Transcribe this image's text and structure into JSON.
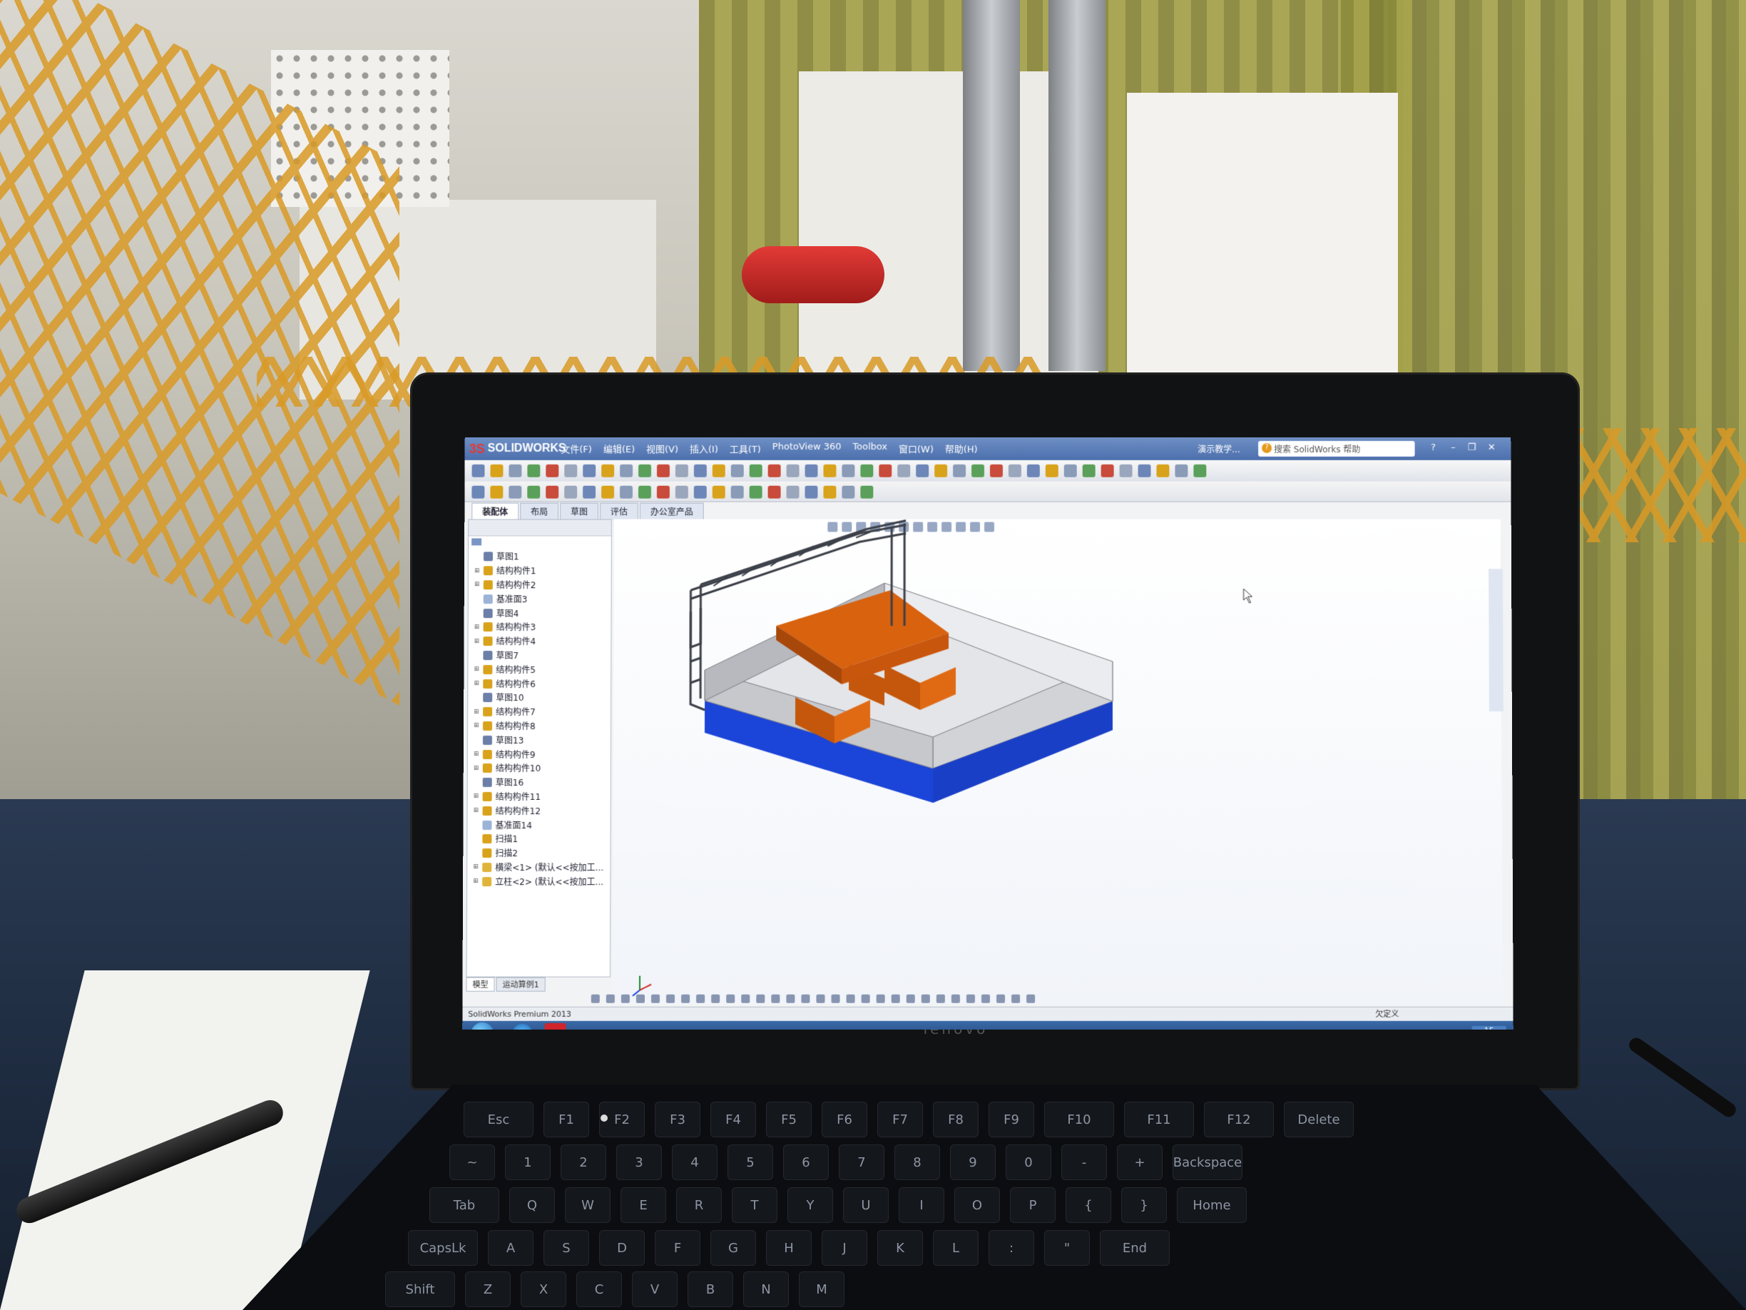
{
  "scene": {
    "description_hidden": ""
  },
  "app": {
    "logo_text": "SOLIDWORKS",
    "logo_prefix": "3S",
    "menu": [
      "文件(F)",
      "编辑(E)",
      "视图(V)",
      "插入(I)",
      "工具(T)",
      "PhotoView 360",
      "Toolbox",
      "窗口(W)",
      "帮助(H)"
    ],
    "demo_label": "演示教学...",
    "search_placeholder": "搜索 SolidWorks 帮助",
    "window_controls": [
      "?",
      "–",
      "❐",
      "✕"
    ]
  },
  "command_tabs": [
    {
      "label": "装配体",
      "active": true
    },
    {
      "label": "布局",
      "active": false
    },
    {
      "label": "草图",
      "active": false
    },
    {
      "label": "评估",
      "active": false
    },
    {
      "label": "办公室产品",
      "active": false
    }
  ],
  "feature_tree": {
    "items": [
      {
        "label": "草图1",
        "type": "sketch"
      },
      {
        "label": "结构构件1",
        "type": "member"
      },
      {
        "label": "结构构件2",
        "type": "member"
      },
      {
        "label": "基准面3",
        "type": "plane"
      },
      {
        "label": "草图4",
        "type": "sketch"
      },
      {
        "label": "结构构件3",
        "type": "member"
      },
      {
        "label": "结构构件4",
        "type": "member"
      },
      {
        "label": "草图7",
        "type": "sketch"
      },
      {
        "label": "结构构件5",
        "type": "member"
      },
      {
        "label": "结构构件6",
        "type": "member"
      },
      {
        "label": "草图10",
        "type": "sketch"
      },
      {
        "label": "结构构件7",
        "type": "member"
      },
      {
        "label": "结构构件8",
        "type": "member"
      },
      {
        "label": "草图13",
        "type": "sketch"
      },
      {
        "label": "结构构件9",
        "type": "member"
      },
      {
        "label": "结构构件10",
        "type": "member"
      },
      {
        "label": "草图16",
        "type": "sketch"
      },
      {
        "label": "结构构件11",
        "type": "member"
      },
      {
        "label": "结构构件12",
        "type": "member"
      },
      {
        "label": "基准面14",
        "type": "plane"
      },
      {
        "label": "扫描1",
        "type": "sweep"
      },
      {
        "label": "扫描2",
        "type": "sweep"
      },
      {
        "label": "横梁<1> (默认<<按加工...",
        "type": "part"
      },
      {
        "label": "立柱<2> (默认<<按加工...",
        "type": "part"
      }
    ],
    "bottom_tabs": [
      {
        "label": "模型",
        "active": true
      },
      {
        "label": "运动算例1",
        "active": false
      }
    ]
  },
  "status_bar": {
    "text": "SolidWorks Premium 2013",
    "right_text": "欠定义"
  },
  "taskbar": {
    "sw_label": "SW",
    "clock": "15"
  },
  "laptop": {
    "brand": "lenovo"
  },
  "keyboard": {
    "row_fn": [
      "Esc",
      "F1",
      "F2",
      "F3",
      "F4",
      "F5",
      "F6",
      "F7",
      "F8",
      "F9",
      "F10",
      "F11",
      "F12",
      "Delete"
    ],
    "row_num": [
      "~",
      "1",
      "2",
      "3",
      "4",
      "5",
      "6",
      "7",
      "8",
      "9",
      "0",
      "-",
      "+",
      "Backspace"
    ],
    "row_q": [
      "Tab",
      "Q",
      "W",
      "E",
      "R",
      "T",
      "Y",
      "U",
      "I",
      "O",
      "P",
      "{",
      "}",
      "Home"
    ],
    "row_a": [
      "CapsLk",
      "A",
      "S",
      "D",
      "F",
      "G",
      "H",
      "J",
      "K",
      "L",
      ":",
      "\"",
      "End"
    ],
    "row_z": [
      "Shift",
      "Z",
      "X",
      "C",
      "V",
      "B",
      "N",
      "M"
    ]
  },
  "colors": {
    "frame": "#3b3f47",
    "base_blue": "#1b44d8",
    "wall_gray": "#cfd0d3",
    "wall_top": "#e6e7ea",
    "table_orange": "#d9620f",
    "table_orange_dark": "#a8470a",
    "titlebar": "#4c6fad"
  }
}
